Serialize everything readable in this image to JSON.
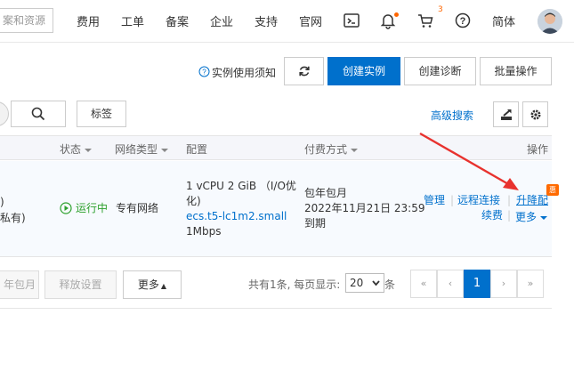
{
  "topnav": {
    "search_placeholder": "案和资源",
    "items": [
      "费用",
      "工单",
      "备案",
      "企业",
      "支持",
      "官网"
    ],
    "cart_count": "3",
    "language": "简体"
  },
  "actions": {
    "notice_label": "实例使用须知",
    "create_instance": "创建实例",
    "create_diagnosis": "创建诊断",
    "batch_ops": "批量操作",
    "tag_button": "标签",
    "advanced_search": "高级搜索"
  },
  "table": {
    "headers": {
      "status": "状态",
      "network_type": "网络类型",
      "config": "配置",
      "pay_method": "付费方式",
      "ops": "操作"
    },
    "row": {
      "name_frag_1": ")",
      "name_frag_2": "私有)",
      "status": "运行中",
      "network": "专有网络",
      "config_line1": "1 vCPU 2 GiB （I/O优",
      "config_line2": "化)",
      "instance_type": "ecs.t5-lc1m2.small",
      "bandwidth": "1Mbps",
      "pay_line1": "包年包月",
      "pay_line2": "2022年11月21日 23:59",
      "pay_line3": "到期",
      "op_manage": "管理",
      "op_remote": "远程连接",
      "op_upgrade": "升降配",
      "op_renew": "续费",
      "op_more": "更多",
      "promo_badge": "惠"
    }
  },
  "footer": {
    "btn_monthly": "年包月",
    "btn_release": "释放设置",
    "btn_more": "更多",
    "total_text": "共有1条, 每页显示:",
    "page_size": "20",
    "page_size_suffix": "条",
    "pages": {
      "first": "«",
      "prev": "‹",
      "current": "1",
      "next": "›",
      "last": "»"
    }
  },
  "colors": {
    "primary": "#0070cc",
    "running": "#2ca02c",
    "arrow": "#e8322e",
    "badge": "#ff6a00"
  }
}
